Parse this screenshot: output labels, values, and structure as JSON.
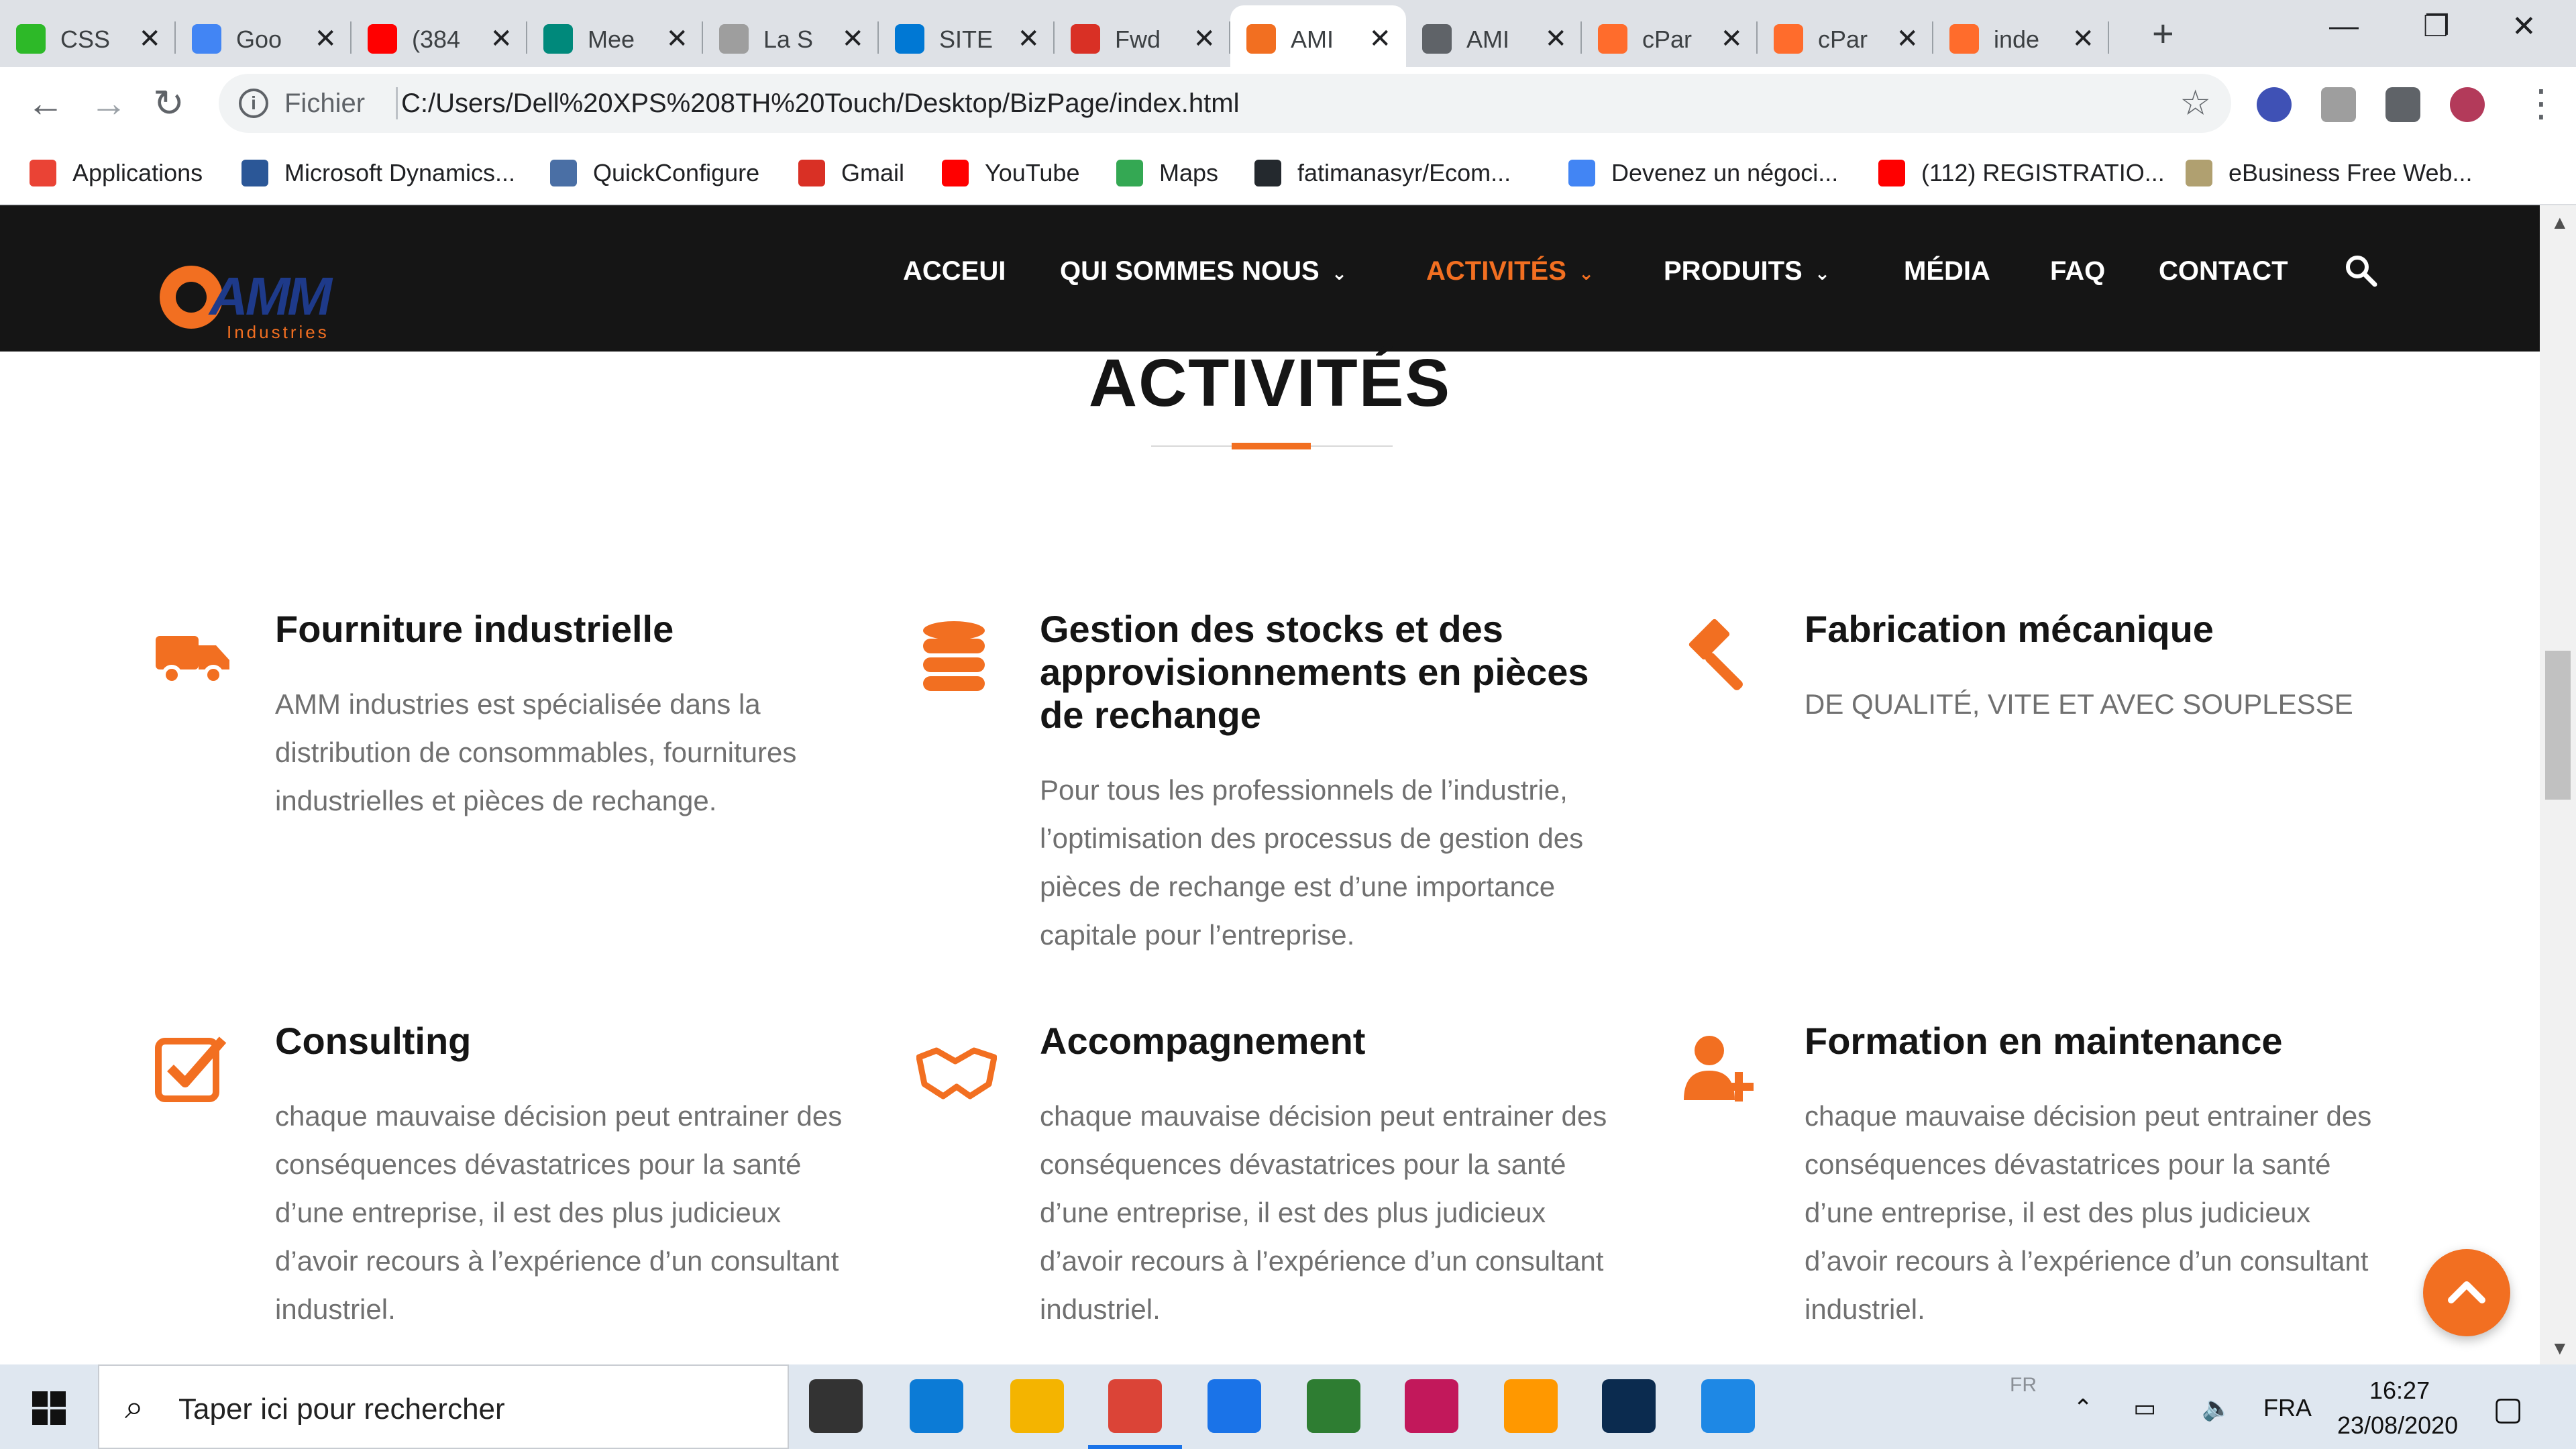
{
  "browser": {
    "tabs": [
      {
        "title": "CSS",
        "icon": "w3c-icon",
        "color": "#2db928"
      },
      {
        "title": "Goo",
        "icon": "google-translate-icon",
        "color": "#4285f4"
      },
      {
        "title": "(384",
        "icon": "youtube-icon",
        "color": "#ff0000"
      },
      {
        "title": "Mee",
        "icon": "meet-icon",
        "color": "#00897b"
      },
      {
        "title": "La S",
        "icon": "bootstrap-icon",
        "color": "#9e9e9e"
      },
      {
        "title": "SITE",
        "icon": "azure-devops-icon",
        "color": "#0078d4"
      },
      {
        "title": "Fwd",
        "icon": "gmail-icon",
        "color": "#d93025"
      },
      {
        "title": "AMI",
        "icon": "amm-favicon-icon",
        "color": "#f26f21",
        "active": true
      },
      {
        "title": "AMI",
        "icon": "globe-icon",
        "color": "#5f6368"
      },
      {
        "title": "cPar",
        "icon": "cpanel-icon",
        "color": "#ff6c2c"
      },
      {
        "title": "cPar",
        "icon": "cpanel-icon",
        "color": "#ff6c2c"
      },
      {
        "title": "inde",
        "icon": "cpanel-icon",
        "color": "#ff6c2c"
      }
    ],
    "new_tab_symbol": "+",
    "close_symbol": "✕",
    "window_controls": {
      "minimize": "—",
      "maximize": "❐",
      "close": "✕"
    },
    "address": {
      "scheme_label": "Fichier",
      "url": "C:/Users/Dell%20XPS%208TH%20Touch/Desktop/BizPage/index.html",
      "info_symbol": "i",
      "star_symbol": "☆"
    },
    "nav": {
      "back": "←",
      "forward": "→",
      "reload": "↻",
      "menu": "⋮"
    },
    "bookmarks": [
      {
        "label": "Applications",
        "icon": "apps-grid-icon",
        "color": "#ea4335"
      },
      {
        "label": "Microsoft Dynamics...",
        "icon": "dynamics-icon",
        "color": "#2b5797"
      },
      {
        "label": "QuickConfigure",
        "icon": "quickconfigure-icon",
        "color": "#4a6fa5"
      },
      {
        "label": "Gmail",
        "icon": "gmail-icon",
        "color": "#d93025"
      },
      {
        "label": "YouTube",
        "icon": "youtube-icon",
        "color": "#ff0000"
      },
      {
        "label": "Maps",
        "icon": "maps-pin-icon",
        "color": "#34a853"
      },
      {
        "label": "fatimanasyr/Ecom...",
        "icon": "github-icon",
        "color": "#24292e"
      },
      {
        "label": "Devenez un négoci...",
        "icon": "google-icon",
        "color": "#4285f4"
      },
      {
        "label": "(112) REGISTRATIO...",
        "icon": "youtube-icon",
        "color": "#ff0000"
      },
      {
        "label": "eBusiness Free Web...",
        "icon": "ebusiness-icon",
        "color": "#b0a070"
      }
    ]
  },
  "site": {
    "logo_text": "AMM",
    "logo_subtext": "Industries",
    "menu": [
      {
        "label": "ACCEUI",
        "dropdown": false,
        "active": false
      },
      {
        "label": "QUI SOMMES NOUS",
        "dropdown": true,
        "active": false
      },
      {
        "label": "ACTIVITÉS",
        "dropdown": true,
        "active": true
      },
      {
        "label": "PRODUITS",
        "dropdown": true,
        "active": false
      },
      {
        "label": "MÉDIA",
        "dropdown": false,
        "active": false
      },
      {
        "label": "FAQ",
        "dropdown": false,
        "active": false
      },
      {
        "label": "CONTACT",
        "dropdown": false,
        "active": false
      }
    ],
    "caret_symbol": "⌄",
    "accent_color": "#f26f21",
    "section_title": "ACTIVITÉS",
    "activities": [
      {
        "icon": "truck-icon",
        "title": "Fourniture industrielle",
        "text": "AMM industries est spécialisée dans la distribution de consommables, fournitures industrielles et pièces de rechange."
      },
      {
        "icon": "database-icon",
        "title": "Gestion des stocks et des approvisionnements en pièces de rechange",
        "text": "Pour tous les professionnels de l’industrie, l’optimisation des processus de gestion des pièces de rechange est d’une importance capitale pour l’entreprise."
      },
      {
        "icon": "hammer-icon",
        "title": "Fabrication mécanique",
        "text": "DE QUALITÉ, VITE ET AVEC SOUPLESSE"
      },
      {
        "icon": "checkbox-icon",
        "title": "Consulting",
        "text": "chaque mauvaise décision peut entrainer des conséquences dévastatrices pour la santé d’une entreprise, il est des plus judicieux d’avoir recours à l’expérience d’un consultant industriel."
      },
      {
        "icon": "handshake-icon",
        "title": "Accompagnement",
        "text": "chaque mauvaise décision peut entrainer des conséquences dévastatrices pour la santé d’une entreprise, il est des plus judicieux d’avoir recours à l’expérience d’un consultant industriel."
      },
      {
        "icon": "user-plus-icon",
        "title": "Formation en maintenance",
        "text": "chaque mauvaise décision peut entrainer des conséquences dévastatrices pour la santé d’une entreprise, il est des plus judicieux d’avoir recours à l’expérience d’un consultant industriel."
      }
    ]
  },
  "taskbar": {
    "search_placeholder": "Taper ici pour rechercher",
    "apps": [
      {
        "icon": "task-view-icon",
        "color": "#333333"
      },
      {
        "icon": "edge-icon",
        "color": "#0c7bd6"
      },
      {
        "icon": "file-explorer-icon",
        "color": "#f4b400"
      },
      {
        "icon": "chrome-icon",
        "color": "#db4437",
        "active": true
      },
      {
        "icon": "mail-icon",
        "color": "#1a73e8"
      },
      {
        "icon": "atom-icon",
        "color": "#2e7d32"
      },
      {
        "icon": "snipping-icon",
        "color": "#c2185b"
      },
      {
        "icon": "sublime-text-icon",
        "color": "#ff9800"
      },
      {
        "icon": "photoshop-icon",
        "color": "#0b2b4f"
      },
      {
        "icon": "photos-icon",
        "color": "#1e88e5"
      }
    ],
    "ime_hint": "FR",
    "language": "FRA",
    "time": "16:27",
    "date": "23/08/2020"
  }
}
